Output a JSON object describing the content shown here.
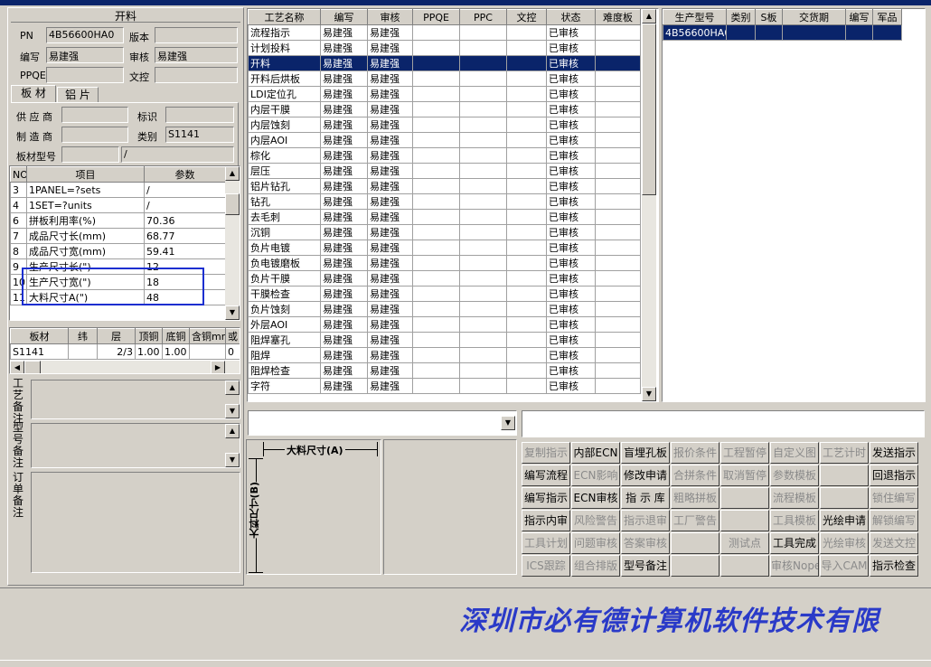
{
  "top_header": "开料",
  "info": {
    "pn_label": "PN",
    "pn_value": "4B56600HA0",
    "version_label": "版本",
    "version_value": "",
    "writer_label": "编写",
    "writer_value": "易建强",
    "reviewer_label": "审核",
    "reviewer_value": "易建强",
    "ppqe_label": "PPQE",
    "ppqe_value": "",
    "doc_label": "文控",
    "doc_value": ""
  },
  "tabs": [
    "板 材",
    "铝 片"
  ],
  "material": {
    "supplier_label": "供 应 商",
    "supplier_value": "",
    "mark_label": "标识",
    "mark_value": "",
    "maker_label": "制 造 商",
    "maker_value": "",
    "category_label": "类别",
    "category_value": "S1141",
    "model_label": "板材型号",
    "model_value": "",
    "model_value2": "/"
  },
  "params": {
    "headers": [
      "NO",
      "项目",
      "参数"
    ],
    "rows": [
      {
        "no": "3",
        "item": "1PANEL=?sets",
        "value": "/"
      },
      {
        "no": "4",
        "item": "1SET=?units",
        "value": "/"
      },
      {
        "no": "6",
        "item": "拼板利用率(%)",
        "value": "70.36"
      },
      {
        "no": "7",
        "item": "成品尺寸长(mm)",
        "value": "68.77"
      },
      {
        "no": "8",
        "item": "成品尺寸宽(mm)",
        "value": "59.41"
      },
      {
        "no": "9",
        "item": "生产尺寸长(\")",
        "value": "12"
      },
      {
        "no": "10",
        "item": "生产尺寸宽(\")",
        "value": "18"
      },
      {
        "no": "11",
        "item": "大料尺寸A(\")",
        "value": "48"
      }
    ]
  },
  "board": {
    "headers": [
      "板材",
      "纬",
      "层",
      "顶铜",
      "底铜",
      "含铜mm",
      "或"
    ],
    "row": [
      "S1141",
      "",
      "2/3",
      "1.00",
      "1.00",
      "",
      "0"
    ]
  },
  "remarks": {
    "process": "工艺备注",
    "model": "型号备注",
    "order": "订单备注"
  },
  "process_table": {
    "headers": [
      "工艺名称",
      "编写",
      "审核",
      "PPQE",
      "PPC",
      "文控",
      "状态",
      "难度板"
    ],
    "rows": [
      [
        "流程指示",
        "易建强",
        "易建强",
        "",
        "",
        "",
        "已审核",
        ""
      ],
      [
        "计划投料",
        "易建强",
        "易建强",
        "",
        "",
        "",
        "已审核",
        ""
      ],
      [
        "开料",
        "易建强",
        "易建强",
        "",
        "",
        "",
        "已审核",
        ""
      ],
      [
        "开料后烘板",
        "易建强",
        "易建强",
        "",
        "",
        "",
        "已审核",
        ""
      ],
      [
        "LDI定位孔",
        "易建强",
        "易建强",
        "",
        "",
        "",
        "已审核",
        ""
      ],
      [
        "内层干膜",
        "易建强",
        "易建强",
        "",
        "",
        "",
        "已审核",
        ""
      ],
      [
        "内层蚀刻",
        "易建强",
        "易建强",
        "",
        "",
        "",
        "已审核",
        ""
      ],
      [
        "内层AOI",
        "易建强",
        "易建强",
        "",
        "",
        "",
        "已审核",
        ""
      ],
      [
        "棕化",
        "易建强",
        "易建强",
        "",
        "",
        "",
        "已审核",
        ""
      ],
      [
        "层压",
        "易建强",
        "易建强",
        "",
        "",
        "",
        "已审核",
        ""
      ],
      [
        "铝片钻孔",
        "易建强",
        "易建强",
        "",
        "",
        "",
        "已审核",
        ""
      ],
      [
        "钻孔",
        "易建强",
        "易建强",
        "",
        "",
        "",
        "已审核",
        ""
      ],
      [
        "去毛刺",
        "易建强",
        "易建强",
        "",
        "",
        "",
        "已审核",
        ""
      ],
      [
        "沉铜",
        "易建强",
        "易建强",
        "",
        "",
        "",
        "已审核",
        ""
      ],
      [
        "负片电镀",
        "易建强",
        "易建强",
        "",
        "",
        "",
        "已审核",
        ""
      ],
      [
        "负电镀磨板",
        "易建强",
        "易建强",
        "",
        "",
        "",
        "已审核",
        ""
      ],
      [
        "负片干膜",
        "易建强",
        "易建强",
        "",
        "",
        "",
        "已审核",
        ""
      ],
      [
        "干膜检查",
        "易建强",
        "易建强",
        "",
        "",
        "",
        "已审核",
        ""
      ],
      [
        "负片蚀刻",
        "易建强",
        "易建强",
        "",
        "",
        "",
        "已审核",
        ""
      ],
      [
        "外层AOI",
        "易建强",
        "易建强",
        "",
        "",
        "",
        "已审核",
        ""
      ],
      [
        "阻焊塞孔",
        "易建强",
        "易建强",
        "",
        "",
        "",
        "已审核",
        ""
      ],
      [
        "阻焊",
        "易建强",
        "易建强",
        "",
        "",
        "",
        "已审核",
        ""
      ],
      [
        "阻焊检查",
        "易建强",
        "易建强",
        "",
        "",
        "",
        "已审核",
        ""
      ],
      [
        "字符",
        "易建强",
        "易建强",
        "",
        "",
        "",
        "已审核",
        ""
      ]
    ],
    "selected_index": 2
  },
  "product_table": {
    "headers": [
      "生产型号",
      "类别",
      "S板",
      "交货期",
      "编写",
      "军品"
    ],
    "rows": [
      [
        "4B56600HA0",
        "",
        "",
        "",
        "",
        ""
      ]
    ]
  },
  "diagram": {
    "a_label": "大料尺寸(A)",
    "b_label": "大料尺寸(B)"
  },
  "buttons": [
    {
      "label": "复制指示",
      "enabled": false
    },
    {
      "label": "内部ECN",
      "enabled": true
    },
    {
      "label": "盲埋孔板",
      "enabled": true
    },
    {
      "label": "报价条件",
      "enabled": false
    },
    {
      "label": "工程暂停",
      "enabled": false
    },
    {
      "label": "自定义图",
      "enabled": false
    },
    {
      "label": "工艺计时",
      "enabled": false
    },
    {
      "label": "发送指示",
      "enabled": true
    },
    {
      "label": "编写流程",
      "enabled": true
    },
    {
      "label": "ECN影响",
      "enabled": false
    },
    {
      "label": "修改申请",
      "enabled": true
    },
    {
      "label": "合拼条件",
      "enabled": false
    },
    {
      "label": "取消暂停",
      "enabled": false
    },
    {
      "label": "参数模板",
      "enabled": false
    },
    {
      "label": "",
      "enabled": false
    },
    {
      "label": "回退指示",
      "enabled": true
    },
    {
      "label": "编写指示",
      "enabled": true
    },
    {
      "label": "ECN审核",
      "enabled": true
    },
    {
      "label": "指 示 库",
      "enabled": true
    },
    {
      "label": "粗略拼板",
      "enabled": false
    },
    {
      "label": "",
      "enabled": false
    },
    {
      "label": "流程模板",
      "enabled": false
    },
    {
      "label": "",
      "enabled": false
    },
    {
      "label": "锁住编写",
      "enabled": false
    },
    {
      "label": "指示内审",
      "enabled": true
    },
    {
      "label": "风险警告",
      "enabled": false
    },
    {
      "label": "指示退审",
      "enabled": false
    },
    {
      "label": "工厂警告",
      "enabled": false
    },
    {
      "label": "",
      "enabled": false
    },
    {
      "label": "工具模板",
      "enabled": false
    },
    {
      "label": "光绘申请",
      "enabled": true
    },
    {
      "label": "解锁编写",
      "enabled": false
    },
    {
      "label": "工具计划",
      "enabled": false
    },
    {
      "label": "问题审核",
      "enabled": false
    },
    {
      "label": "答案审核",
      "enabled": false
    },
    {
      "label": "",
      "enabled": false
    },
    {
      "label": "测试点",
      "enabled": false
    },
    {
      "label": "工具完成",
      "enabled": true
    },
    {
      "label": "光绘审核",
      "enabled": false
    },
    {
      "label": "发送文控",
      "enabled": false
    },
    {
      "label": "ICS跟踪",
      "enabled": false
    },
    {
      "label": "组合排版",
      "enabled": false
    },
    {
      "label": "型号备注",
      "enabled": true
    },
    {
      "label": "",
      "enabled": false
    },
    {
      "label": "",
      "enabled": false
    },
    {
      "label": "审核Nope",
      "enabled": false
    },
    {
      "label": "导入CAM",
      "enabled": false
    },
    {
      "label": "指示检查",
      "enabled": true
    }
  ],
  "banner": "深圳市必有德计算机软件技术有限",
  "colors": {
    "selection": "#0a246a",
    "highlight_box": "#1c2fd0",
    "banner": "#2a3ac8"
  }
}
